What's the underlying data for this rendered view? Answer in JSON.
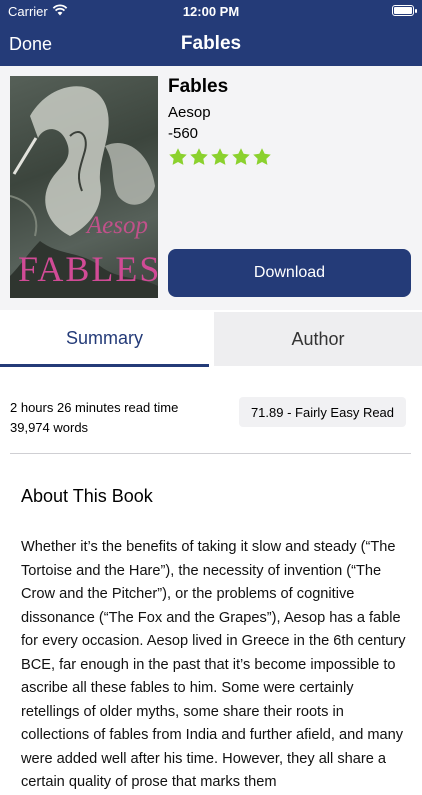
{
  "status_bar": {
    "carrier": "Carrier",
    "time": "12:00 PM"
  },
  "nav": {
    "done_label": "Done",
    "title": "Fables"
  },
  "book": {
    "title": "Fables",
    "author": "Aesop",
    "year": "-560",
    "rating": 5,
    "rating_max": 5,
    "cover": {
      "author_text": "Aesop",
      "title_text": "FABLES"
    },
    "download_label": "Download"
  },
  "tabs": [
    {
      "label": "Summary",
      "selected": true
    },
    {
      "label": "Author",
      "selected": false
    }
  ],
  "meta": {
    "read_time": "2 hours 26 minutes read time",
    "word_count": "39,974 words",
    "readability": "71.89 - Fairly Easy Read"
  },
  "about": {
    "heading": "About This Book",
    "body": "Whether it’s the benefits of taking it slow and steady (“The Tortoise and the Hare”), the necessity of invention (“The Crow and the Pitcher”), or the problems of cognitive dissonance (“The Fox and the Grapes”), Aesop has a fable for every occasion. Aesop lived in Greece in the 6th century BCE, far enough in the past that it’s become impossible to ascribe all these fables to him. Some were certainly retellings of older myths, some share their roots in collections of fables from India and further afield, and many were added well after his time. However, they all share a certain quality of prose that marks them"
  },
  "colors": {
    "brand": "#243b78",
    "star": "#8bd12e"
  },
  "icons": {
    "wifi": "wifi-icon",
    "battery": "battery-icon",
    "star": "star-icon"
  }
}
